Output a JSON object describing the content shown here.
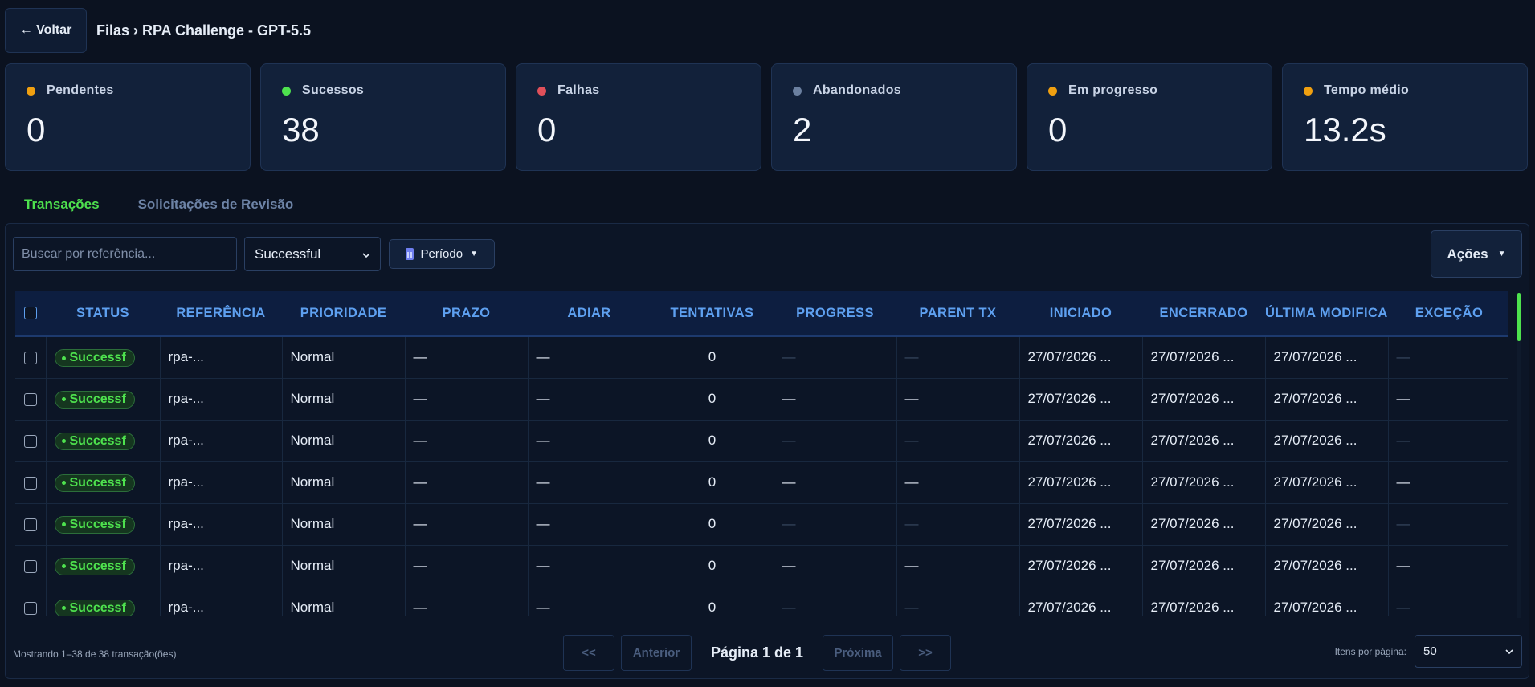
{
  "header": {
    "back_label": "← Voltar",
    "breadcrumb": "Filas › RPA Challenge - GPT-5.5"
  },
  "stats": [
    {
      "label": "Pendentes",
      "value": "0",
      "color": "#f0a010"
    },
    {
      "label": "Sucessos",
      "value": "38",
      "color": "#4ee24e"
    },
    {
      "label": "Falhas",
      "value": "0",
      "color": "#e0505a"
    },
    {
      "label": "Abandonados",
      "value": "2",
      "color": "#6b80a0"
    },
    {
      "label": "Em progresso",
      "value": "0",
      "color": "#f0a010"
    },
    {
      "label": "Tempo médio",
      "value": "13.2s",
      "color": "#f0a010"
    }
  ],
  "tabs": [
    {
      "label": "Transações",
      "active": true
    },
    {
      "label": "Solicitações de Revisão",
      "active": false
    }
  ],
  "filters": {
    "search_placeholder": "Buscar por referência...",
    "status_selected": "Successful",
    "periodo_label": "Período",
    "acoes_label": "Ações"
  },
  "table": {
    "columns": [
      "STATUS",
      "REFERÊNCIA",
      "PRIORIDADE",
      "PRAZO",
      "ADIAR",
      "TENTATIVAS",
      "PROGRESS",
      "PARENT TX",
      "INICIADO",
      "ENCERRADO",
      "ÚLTIMA MODIFICAÇÃO",
      "EXCEÇÃO"
    ],
    "rows": [
      {
        "status": "Successf",
        "ref": "rpa-...",
        "priority": "Normal",
        "prazo": "—",
        "adiar": "—",
        "tentativas": "0",
        "progress": "—",
        "parent": "—",
        "iniciado": "27/07/2026 ...",
        "encerrado": "27/07/2026 ...",
        "modificacao": "27/07/2026 ...",
        "excecao": "—",
        "dim": true
      },
      {
        "status": "Successf",
        "ref": "rpa-...",
        "priority": "Normal",
        "prazo": "—",
        "adiar": "—",
        "tentativas": "0",
        "progress": "—",
        "parent": "—",
        "iniciado": "27/07/2026 ...",
        "encerrado": "27/07/2026 ...",
        "modificacao": "27/07/2026 ...",
        "excecao": "—",
        "dim": false
      },
      {
        "status": "Successf",
        "ref": "rpa-...",
        "priority": "Normal",
        "prazo": "—",
        "adiar": "—",
        "tentativas": "0",
        "progress": "—",
        "parent": "—",
        "iniciado": "27/07/2026 ...",
        "encerrado": "27/07/2026 ...",
        "modificacao": "27/07/2026 ...",
        "excecao": "—",
        "dim": true
      },
      {
        "status": "Successf",
        "ref": "rpa-...",
        "priority": "Normal",
        "prazo": "—",
        "adiar": "—",
        "tentativas": "0",
        "progress": "—",
        "parent": "—",
        "iniciado": "27/07/2026 ...",
        "encerrado": "27/07/2026 ...",
        "modificacao": "27/07/2026 ...",
        "excecao": "—",
        "dim": false
      },
      {
        "status": "Successf",
        "ref": "rpa-...",
        "priority": "Normal",
        "prazo": "—",
        "adiar": "—",
        "tentativas": "0",
        "progress": "—",
        "parent": "—",
        "iniciado": "27/07/2026 ...",
        "encerrado": "27/07/2026 ...",
        "modificacao": "27/07/2026 ...",
        "excecao": "—",
        "dim": true
      },
      {
        "status": "Successf",
        "ref": "rpa-...",
        "priority": "Normal",
        "prazo": "—",
        "adiar": "—",
        "tentativas": "0",
        "progress": "—",
        "parent": "—",
        "iniciado": "27/07/2026 ...",
        "encerrado": "27/07/2026 ...",
        "modificacao": "27/07/2026 ...",
        "excecao": "—",
        "dim": false
      },
      {
        "status": "Successf",
        "ref": "rpa-...",
        "priority": "Normal",
        "prazo": "—",
        "adiar": "—",
        "tentativas": "0",
        "progress": "—",
        "parent": "—",
        "iniciado": "27/07/2026 ...",
        "encerrado": "27/07/2026 ...",
        "modificacao": "27/07/2026 ...",
        "excecao": "—",
        "dim": true
      }
    ]
  },
  "footer": {
    "mostrando": "Mostrando 1–38 de 38 transação(ões)",
    "first_label": "<<",
    "prev_label": "Anterior",
    "page_info": "Página 1 de 1",
    "next_label": "Próxima",
    "last_label": ">>",
    "itens_label": "Itens por página:",
    "itens_value": "50"
  }
}
